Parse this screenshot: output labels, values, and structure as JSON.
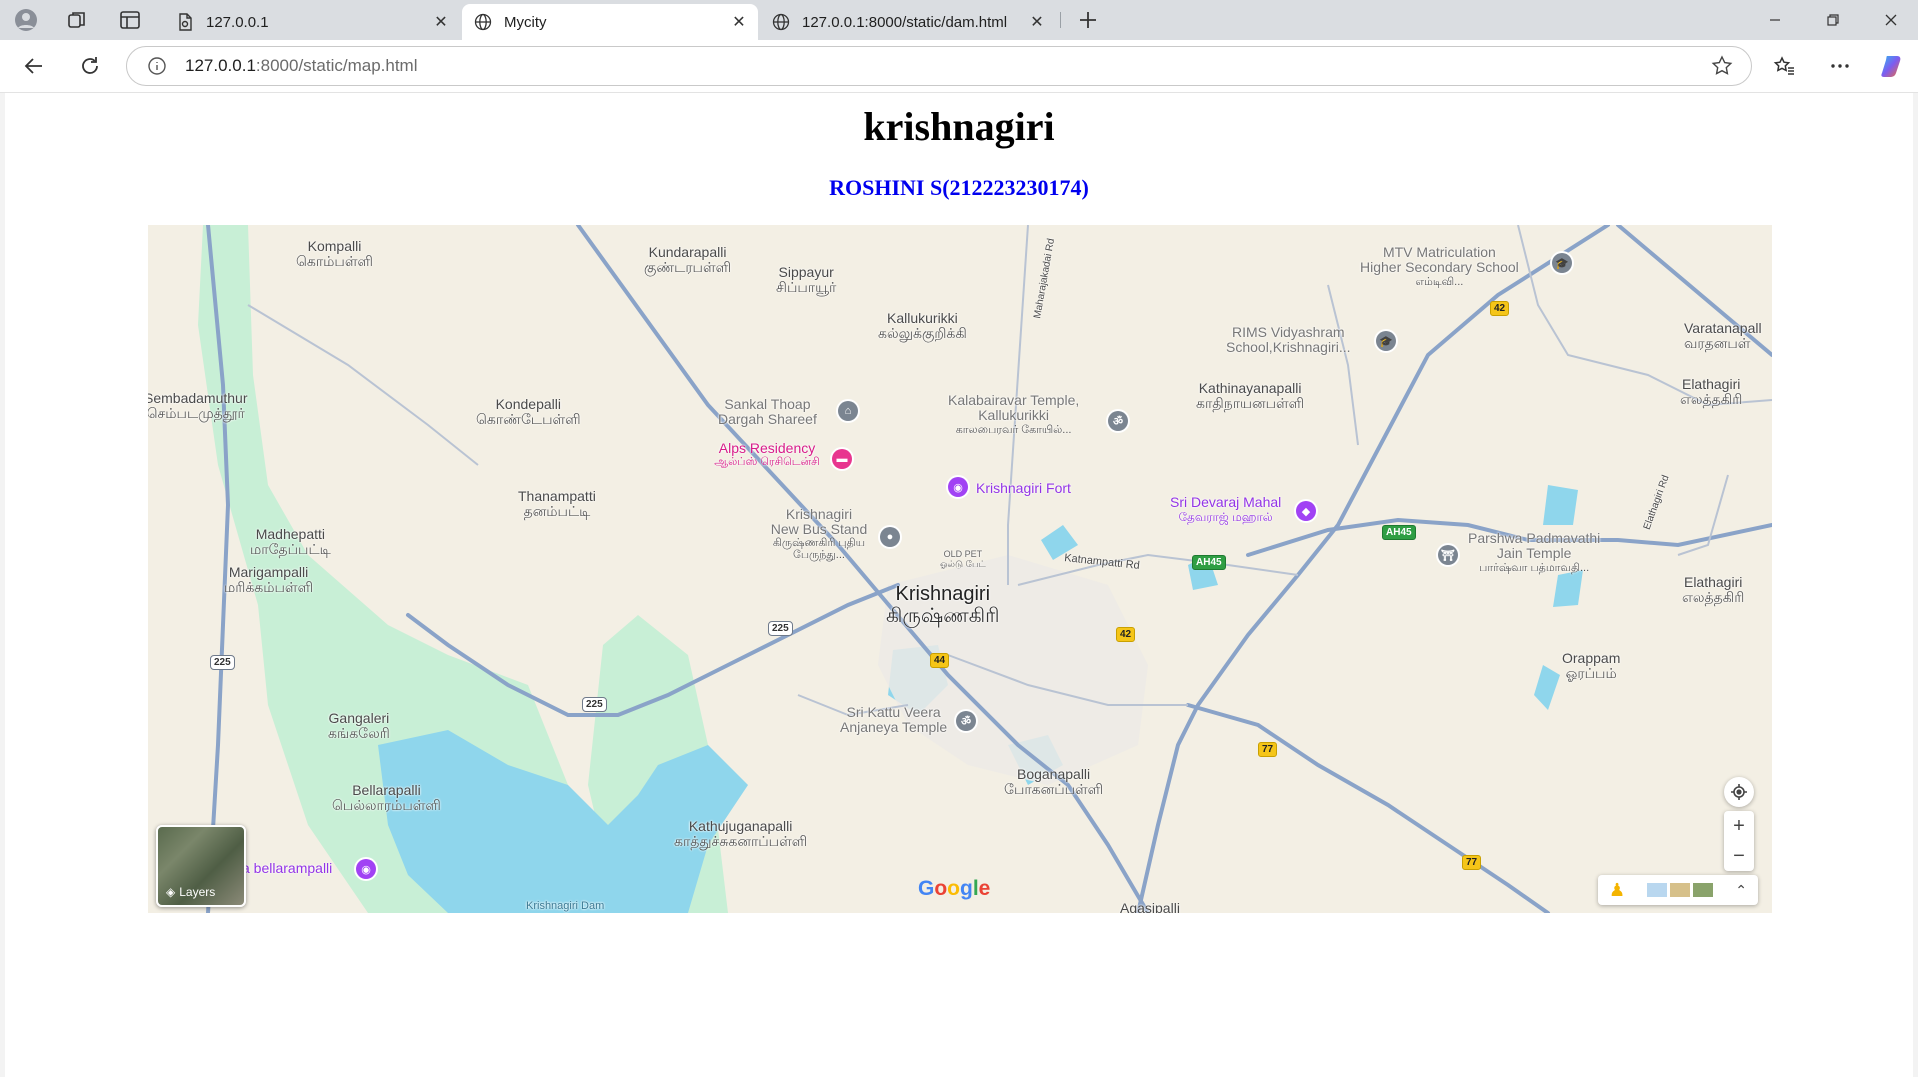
{
  "browser": {
    "tabs": [
      {
        "title": "127.0.0.1",
        "active": false
      },
      {
        "title": "Mycity",
        "active": true
      },
      {
        "title": "127.0.0.1:8000/static/dam.html",
        "active": false
      }
    ],
    "url_host": "127.0.0.1",
    "url_rest": ":8000/static/map.html",
    "icons": [
      "profile-icon",
      "workspaces-icon",
      "tab-actions-icon",
      "new-tab-icon",
      "back-icon",
      "refresh-icon",
      "site-info-icon",
      "favorite-star-icon",
      "favorites-icon",
      "more-icon",
      "copilot-icon",
      "minimize-icon",
      "maximize-icon",
      "close-window-icon"
    ]
  },
  "page": {
    "title": "krishnagiri",
    "subtitle": "ROSHINI S(212223230174)"
  },
  "map": {
    "colors": {
      "land": "#f3efe4",
      "water": "#8fd6ec",
      "park": "#c8efd6",
      "road": "#8aa3c8"
    },
    "labels": {
      "kompalli": {
        "en": "Kompalli",
        "ta": "கொம்பள்ளி"
      },
      "kundarapalli": {
        "en": "Kundarapalli",
        "ta": "குண்டரபள்ளி"
      },
      "sippayur": {
        "en": "Sippayur",
        "ta": "சிப்பாயூர்"
      },
      "kallukurikki": {
        "en": "Kallukurikki",
        "ta": "கல்லுக்குறிக்கி"
      },
      "mtv": {
        "en1": "MTV Matriculation",
        "en2": "Higher Secondary School",
        "ta": "எம்டிவி..."
      },
      "rims": {
        "en1": "RIMS Vidyashram",
        "en2": "School,Krishnagiri..."
      },
      "varatanapall": {
        "en": "Varatanapall",
        "ta": "வரதனபள்"
      },
      "sembadamuthur": {
        "en": "Sembadamuthur",
        "ta": "செம்படமுத்தூர்"
      },
      "kondepalli": {
        "en": "Kondepalli",
        "ta": "கொண்டேபள்ளி"
      },
      "sankal": {
        "en1": "Sankal Thoap",
        "en2": "Dargah Shareef"
      },
      "kalabairavar": {
        "en1": "Kalabairavar Temple,",
        "en2": "Kallukurikki",
        "ta": "காலபைரவர் கோயில்..."
      },
      "kathinayanapalli": {
        "en": "Kathinayanapalli",
        "ta": "காதிநாயனபள்ளி"
      },
      "elathagiri_n": {
        "en": "Elathagiri",
        "ta": "எலத்தகிரி"
      },
      "alps": {
        "en": "Alps Residency",
        "ta": "ஆல்ப்ஸ் ரெசிடென்சி"
      },
      "fort": {
        "en": "Krishnagiri Fort"
      },
      "thanampatti": {
        "en": "Thanampatti",
        "ta": "தனம்பட்டி"
      },
      "devaraj": {
        "en": "Sri Devaraj Mahal",
        "ta": "தேவராஜ் மஹால்"
      },
      "madhepatti": {
        "en": "Madhepatti",
        "ta": "மாதேப்பட்டி"
      },
      "busstand": {
        "en1": "Krishnagiri",
        "en2": "New Bus Stand",
        "ta": "கிருஷ்ணகிரி புதிய பேருந்து..."
      },
      "oldpet": {
        "en": "OLD PET",
        "ta": "ஓல்டு பேட்"
      },
      "katnampatti": {
        "en": "Katnampatti Rd"
      },
      "parshwa": {
        "en1": "Parshwa Padmavathi",
        "en2": "Jain Temple",
        "ta": "பார்ஷ்வா பத்மாவதி..."
      },
      "marigampalli": {
        "en": "Marigampalli",
        "ta": "மரிக்கம்பள்ளி"
      },
      "krishnagiri": {
        "en": "Krishnagiri",
        "ta": "கிருஷ்ணகிரி"
      },
      "elathagiri_s": {
        "en": "Elathagiri",
        "ta": "எலத்தகிரி"
      },
      "orappam": {
        "en": "Orappam",
        "ta": "ஓரப்பம்"
      },
      "anjaneya": {
        "en1": "Sri Kattu Veera",
        "en2": "Anjaneya Temple"
      },
      "gangaleri": {
        "en": "Gangaleri",
        "ta": "கங்கலேரி"
      },
      "boganapalli": {
        "en": "Boganapalli",
        "ta": "போகனப்பள்ளி"
      },
      "bellarapalli": {
        "en": "Bellarapalli",
        "ta": "பெல்லாரம்பள்ளி"
      },
      "kathujuganapalli": {
        "en": "Kathujuganapalli",
        "ta": "காத்துச்சுகனாப்பள்ளி"
      },
      "bellarampalli_poi": {
        "en": "a bellarampalli"
      },
      "dam": {
        "en": "Krishnagiri Dam"
      },
      "agasipalli": {
        "en": "Agasipalli"
      },
      "maharajakadai": {
        "en": "Maharajakadai Rd"
      },
      "elathagiri_rd": {
        "en": "Elathagiri Rd"
      }
    },
    "shields": {
      "r42a": "42",
      "r42b": "42",
      "r44": "44",
      "r77a": "77",
      "r77b": "77",
      "ah45a": "AH45",
      "ah45b": "AH45",
      "r225a": "225",
      "r225b": "225",
      "r225c": "225"
    },
    "layers_label": "Layers",
    "google": [
      "G",
      "o",
      "o",
      "g",
      "l",
      "e"
    ],
    "google_colors": [
      "#4285F4",
      "#EA4335",
      "#FBBC05",
      "#4285F4",
      "#34A853",
      "#EA4335"
    ]
  }
}
